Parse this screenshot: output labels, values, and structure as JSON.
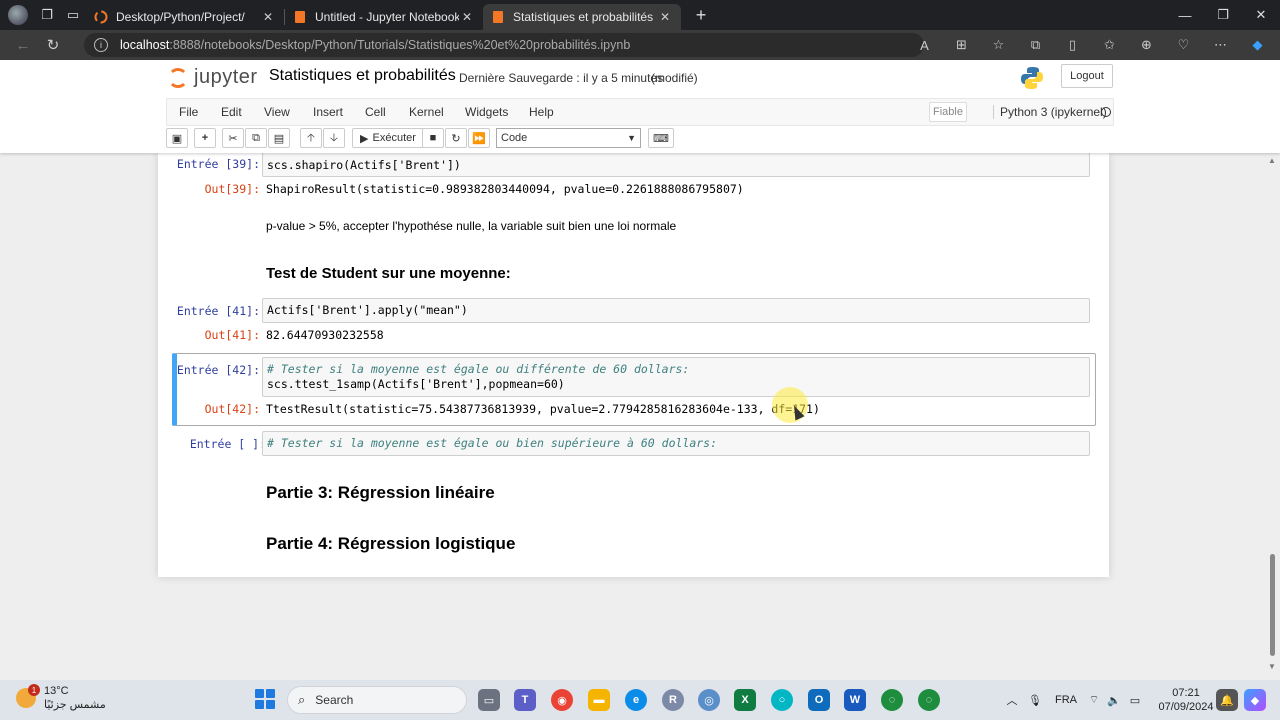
{
  "browser": {
    "tabs": [
      {
        "label": "Desktop/Python/Project/",
        "active": false
      },
      {
        "label": "Untitled - Jupyter Notebook",
        "active": false
      },
      {
        "label": "Statistiques et probabilités - Jupy",
        "active": true
      }
    ],
    "url_host": "localhost",
    "url_path": ":8888/notebooks/Desktop/Python/Tutorials/Statistiques%20et%20probabilités.ipynb"
  },
  "jupyter": {
    "logo_text": "jupyter",
    "title": "Statistiques et probabilités",
    "save_status": "Dernière Sauvegarde : il y a 5 minutes",
    "modified": "(modifié)",
    "logout": "Logout",
    "menu": [
      "File",
      "Edit",
      "View",
      "Insert",
      "Cell",
      "Kernel",
      "Widgets",
      "Help"
    ],
    "trusted": "Fiable",
    "kernel": "Python 3 (ipykernel)",
    "run_label": "Exécuter",
    "cell_type": "Code"
  },
  "cells": {
    "c39": {
      "in_prompt": "Entrée [39]:",
      "code": "scs.shapiro(Actifs['Brent'])",
      "out_prompt": "Out[39]:",
      "output": "ShapiroResult(statistic=0.989382803440094, pvalue=0.2261888086795807)"
    },
    "md1": "p-value > 5%, accepter l'hypothése nulle, la variable suit bien une loi normale",
    "h1": "Test de Student sur une moyenne:",
    "c41": {
      "in_prompt": "Entrée [41]:",
      "code": "Actifs['Brent'].apply(\"mean\")",
      "out_prompt": "Out[41]:",
      "output": "82.64470930232558"
    },
    "c42": {
      "in_prompt": "Entrée [42]:",
      "comment": "# Tester si la moyenne est égale ou différente de 60 dollars:",
      "code": "scs.ttest_1samp(Actifs['Brent'],popmean=60)",
      "out_prompt": "Out[42]:",
      "output": "TtestResult(statistic=75.54387736813939, pvalue=2.7794285816283604e-133, df=171)"
    },
    "c43": {
      "in_prompt": "Entrée [ ]:",
      "comment": "# Tester si la moyenne est égale ou bien supérieure à 60 dollars:"
    },
    "h2": "Partie 3: Régression linéaire",
    "h3": "Partie 4: Régression logistique"
  },
  "taskbar": {
    "temp": "13°C",
    "weather_desc": "مشمس جزئيًا",
    "weather_badge": "1",
    "search": "Search",
    "lang": "FRA",
    "time": "07:21",
    "date": "07/09/2024"
  }
}
